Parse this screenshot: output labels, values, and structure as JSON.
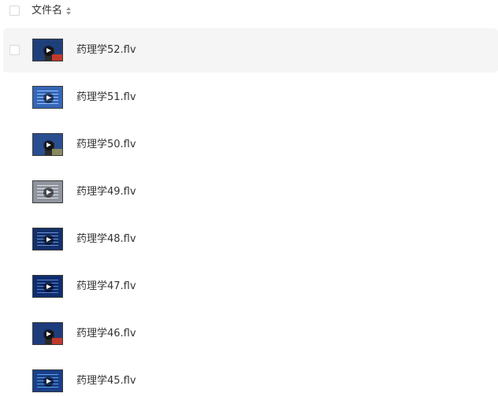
{
  "header": {
    "column_label": "文件名"
  },
  "files": [
    {
      "name": "药理学52.flv",
      "thumb_style": "lecture",
      "bg": "#1f3f7a",
      "accent": "#c0392b",
      "hover": true
    },
    {
      "name": "药理学51.flv",
      "thumb_style": "slide",
      "bg": "#3566b8",
      "accent": "#9cc3ff",
      "hover": false
    },
    {
      "name": "药理学50.flv",
      "thumb_style": "lecture",
      "bg": "#2a4f90",
      "accent": "#8a8a60",
      "hover": false
    },
    {
      "name": "药理学49.flv",
      "thumb_style": "slide",
      "bg": "#8f959e",
      "accent": "#dfe3e8",
      "hover": false
    },
    {
      "name": "药理学48.flv",
      "thumb_style": "slide",
      "bg": "#14306b",
      "accent": "#6b8fd6",
      "hover": false
    },
    {
      "name": "药理学47.flv",
      "thumb_style": "slide",
      "bg": "#0f2d6e",
      "accent": "#5c7fd0",
      "hover": false
    },
    {
      "name": "药理学46.flv",
      "thumb_style": "lecture",
      "bg": "#1e3c7c",
      "accent": "#c0392b",
      "hover": false
    },
    {
      "name": "药理学45.flv",
      "thumb_style": "slide",
      "bg": "#1a3f8a",
      "accent": "#5fa0e0",
      "hover": false
    }
  ]
}
